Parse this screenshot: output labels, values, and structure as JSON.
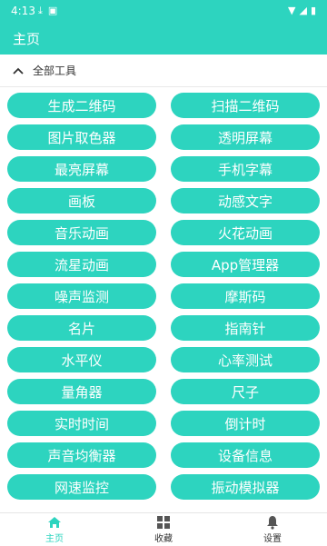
{
  "status_bar": {
    "time": "4:13",
    "left_icons": [
      "download-icon",
      "square-icon"
    ],
    "right_icons": [
      "wifi-icon",
      "signal-icon",
      "battery-icon"
    ]
  },
  "app_bar": {
    "title": "主页"
  },
  "section": {
    "label": "全部工具",
    "expanded": true
  },
  "tools": [
    [
      "生成二维码",
      "扫描二维码"
    ],
    [
      "图片取色器",
      "透明屏幕"
    ],
    [
      "最亮屏幕",
      "手机字幕"
    ],
    [
      "画板",
      "动感文字"
    ],
    [
      "音乐动画",
      "火花动画"
    ],
    [
      "流星动画",
      "App管理器"
    ],
    [
      "噪声监测",
      "摩斯码"
    ],
    [
      "名片",
      "指南针"
    ],
    [
      "水平仪",
      "心率测试"
    ],
    [
      "量角器",
      "尺子"
    ],
    [
      "实时时间",
      "倒计时"
    ],
    [
      "声音均衡器",
      "设备信息"
    ],
    [
      "网速监控",
      "振动模拟器"
    ]
  ],
  "bottom_nav": [
    {
      "label": "主页",
      "icon": "home-icon",
      "active": true
    },
    {
      "label": "收藏",
      "icon": "grid-icon",
      "active": false
    },
    {
      "label": "设置",
      "icon": "bell-icon",
      "active": false
    }
  ],
  "colors": {
    "accent": "#2dd4bf",
    "text": "#333333",
    "background": "#ffffff"
  }
}
